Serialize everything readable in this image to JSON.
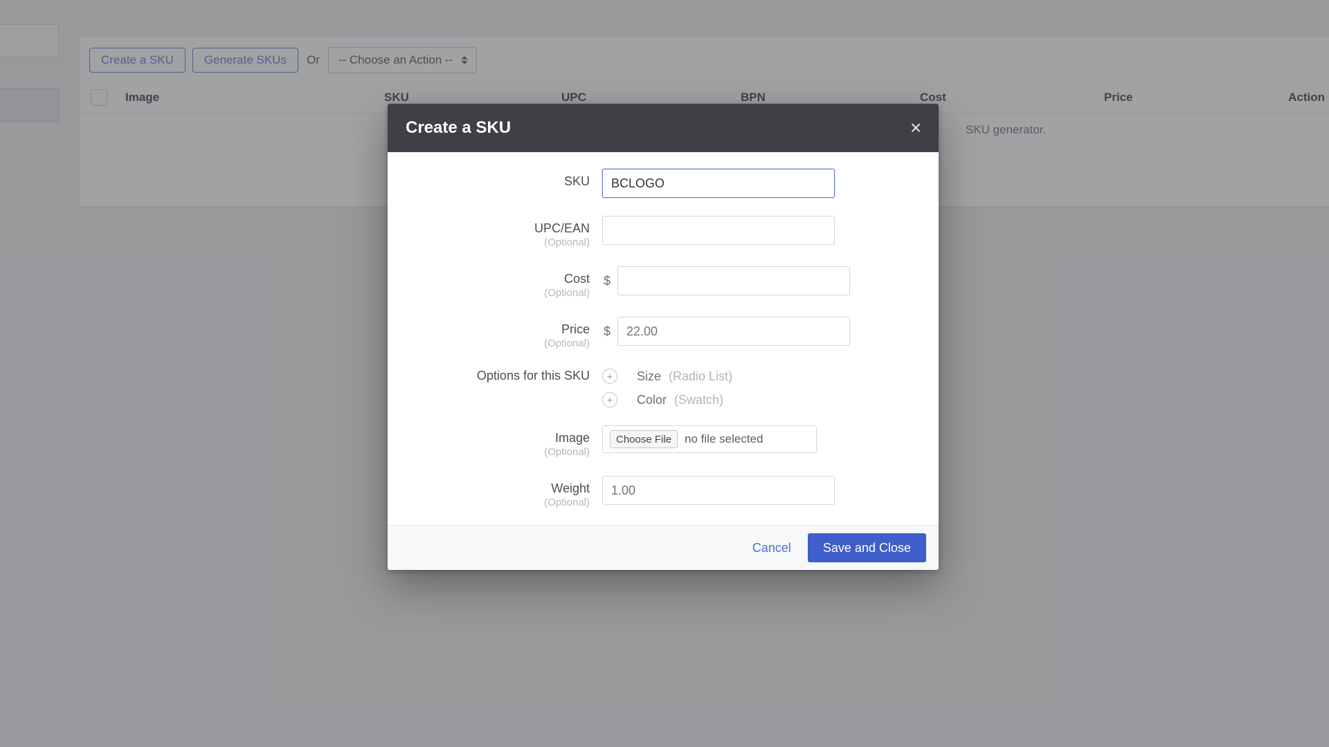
{
  "toolbar": {
    "create_label": "Create a SKU",
    "generate_label": "Generate SKUs",
    "or_label": "Or",
    "action_select": "-- Choose an Action --"
  },
  "table": {
    "columns": {
      "image": "Image",
      "sku": "SKU",
      "upc": "UPC",
      "bpn": "BPN",
      "cost": "Cost",
      "price": "Price",
      "action": "Action"
    },
    "hint": "SKU generator."
  },
  "modal": {
    "title": "Create a SKU",
    "optional_label": "(Optional)",
    "fields": {
      "sku": {
        "label": "SKU",
        "value": "BCLOGO"
      },
      "upc": {
        "label": "UPC/EAN",
        "value": ""
      },
      "cost": {
        "label": "Cost",
        "currency": "$",
        "value": ""
      },
      "price": {
        "label": "Price",
        "currency": "$",
        "placeholder": "22.00"
      },
      "options": {
        "label": "Options for this SKU"
      },
      "image": {
        "label": "Image",
        "choose_label": "Choose File",
        "file_msg": "no file selected"
      },
      "weight": {
        "label": "Weight",
        "placeholder": "1.00"
      }
    },
    "options": [
      {
        "name": "Size",
        "type": "(Radio List)"
      },
      {
        "name": "Color",
        "type": "(Swatch)"
      }
    ],
    "buttons": {
      "cancel": "Cancel",
      "save": "Save and Close"
    }
  }
}
